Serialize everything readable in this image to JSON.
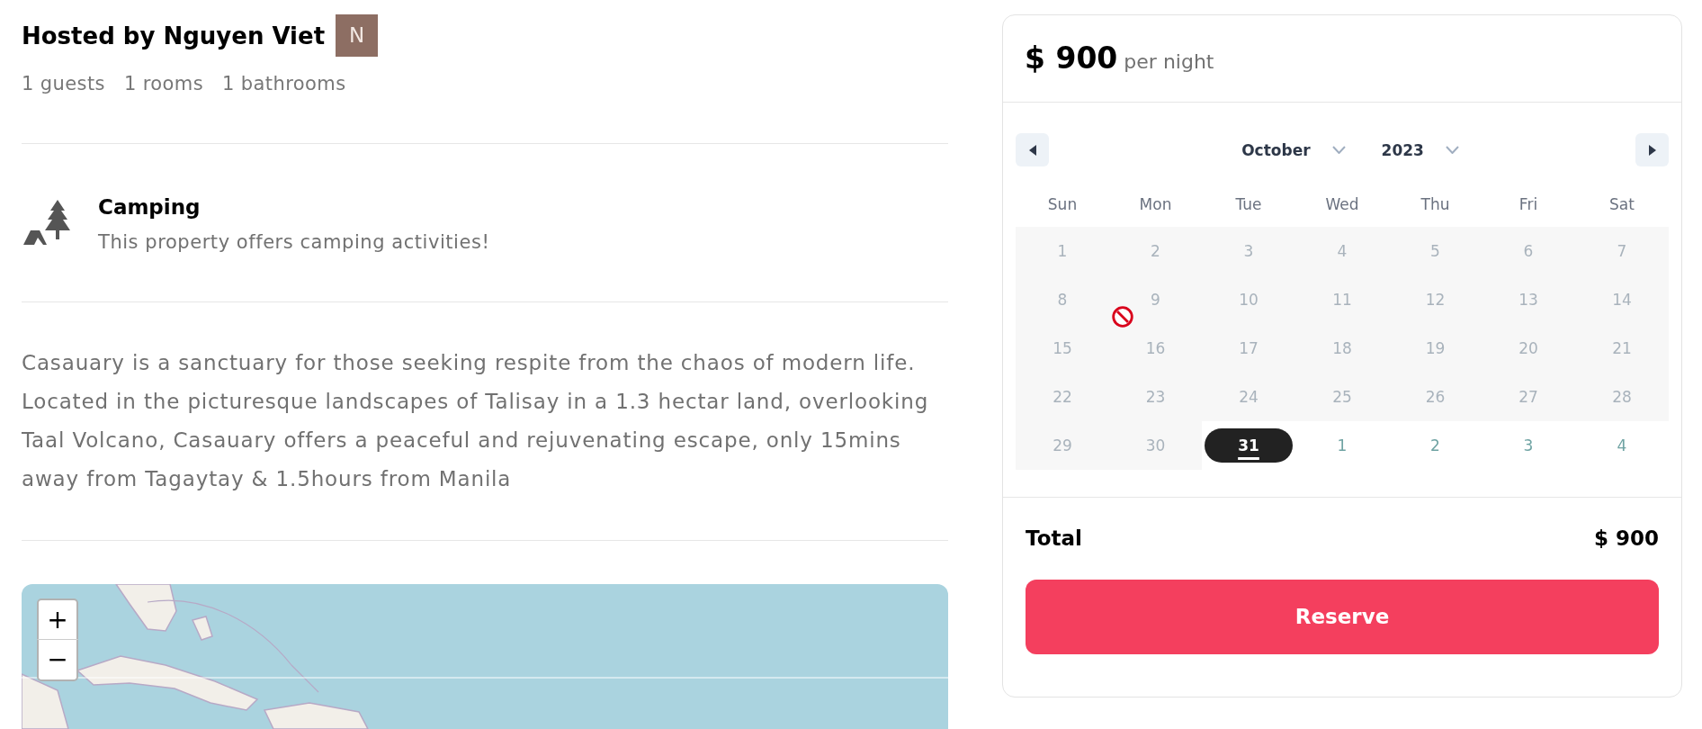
{
  "host": {
    "title": "Hosted by Nguyen Viet",
    "avatar_initial": "N"
  },
  "stats": [
    "1 guests",
    "1 rooms",
    "1 bathrooms"
  ],
  "amenity": {
    "title": "Camping",
    "description": "This property offers camping activities!"
  },
  "description": "Casauary is a sanctuary for those seeking respite from the chaos of modern life. Located in the picturesque landscapes of Talisay in a 1.3 hectar land, overlooking Taal Volcano, Casauary offers a peaceful and rejuvenating escape, only 15mins away from Tagaytay & 1.5hours from Manila",
  "map": {
    "zoom_in": "+",
    "zoom_out": "−"
  },
  "booking": {
    "price": "$ 900",
    "price_unit": "per night",
    "calendar": {
      "month": "October",
      "year": "2023",
      "weekdays": [
        "Sun",
        "Mon",
        "Tue",
        "Wed",
        "Thu",
        "Fri",
        "Sat"
      ],
      "weeks": [
        [
          {
            "label": "1",
            "disabled": true,
            "outside": false,
            "selected": false,
            "today": false
          },
          {
            "label": "2",
            "disabled": true,
            "outside": false,
            "selected": false,
            "today": false
          },
          {
            "label": "3",
            "disabled": true,
            "outside": false,
            "selected": false,
            "today": false
          },
          {
            "label": "4",
            "disabled": true,
            "outside": false,
            "selected": false,
            "today": false
          },
          {
            "label": "5",
            "disabled": true,
            "outside": false,
            "selected": false,
            "today": false
          },
          {
            "label": "6",
            "disabled": true,
            "outside": false,
            "selected": false,
            "today": false
          },
          {
            "label": "7",
            "disabled": true,
            "outside": false,
            "selected": false,
            "today": false
          }
        ],
        [
          {
            "label": "8",
            "disabled": true,
            "outside": false,
            "selected": false,
            "today": false
          },
          {
            "label": "9",
            "disabled": true,
            "outside": false,
            "selected": false,
            "today": false
          },
          {
            "label": "10",
            "disabled": true,
            "outside": false,
            "selected": false,
            "today": false
          },
          {
            "label": "11",
            "disabled": true,
            "outside": false,
            "selected": false,
            "today": false
          },
          {
            "label": "12",
            "disabled": true,
            "outside": false,
            "selected": false,
            "today": false
          },
          {
            "label": "13",
            "disabled": true,
            "outside": false,
            "selected": false,
            "today": false
          },
          {
            "label": "14",
            "disabled": true,
            "outside": false,
            "selected": false,
            "today": false
          }
        ],
        [
          {
            "label": "15",
            "disabled": true,
            "outside": false,
            "selected": false,
            "today": false
          },
          {
            "label": "16",
            "disabled": true,
            "outside": false,
            "selected": false,
            "today": false
          },
          {
            "label": "17",
            "disabled": true,
            "outside": false,
            "selected": false,
            "today": false
          },
          {
            "label": "18",
            "disabled": true,
            "outside": false,
            "selected": false,
            "today": false
          },
          {
            "label": "19",
            "disabled": true,
            "outside": false,
            "selected": false,
            "today": false
          },
          {
            "label": "20",
            "disabled": true,
            "outside": false,
            "selected": false,
            "today": false
          },
          {
            "label": "21",
            "disabled": true,
            "outside": false,
            "selected": false,
            "today": false
          }
        ],
        [
          {
            "label": "22",
            "disabled": true,
            "outside": false,
            "selected": false,
            "today": false
          },
          {
            "label": "23",
            "disabled": true,
            "outside": false,
            "selected": false,
            "today": false
          },
          {
            "label": "24",
            "disabled": true,
            "outside": false,
            "selected": false,
            "today": false
          },
          {
            "label": "25",
            "disabled": true,
            "outside": false,
            "selected": false,
            "today": false
          },
          {
            "label": "26",
            "disabled": true,
            "outside": false,
            "selected": false,
            "today": false
          },
          {
            "label": "27",
            "disabled": true,
            "outside": false,
            "selected": false,
            "today": false
          },
          {
            "label": "28",
            "disabled": true,
            "outside": false,
            "selected": false,
            "today": false
          }
        ],
        [
          {
            "label": "29",
            "disabled": true,
            "outside": false,
            "selected": false,
            "today": false
          },
          {
            "label": "30",
            "disabled": true,
            "outside": false,
            "selected": false,
            "today": false
          },
          {
            "label": "31",
            "disabled": false,
            "outside": false,
            "selected": true,
            "today": true
          },
          {
            "label": "1",
            "disabled": false,
            "outside": true,
            "selected": false,
            "today": false
          },
          {
            "label": "2",
            "disabled": false,
            "outside": true,
            "selected": false,
            "today": false
          },
          {
            "label": "3",
            "disabled": false,
            "outside": true,
            "selected": false,
            "today": false
          },
          {
            "label": "4",
            "disabled": false,
            "outside": true,
            "selected": false,
            "today": false
          }
        ]
      ]
    },
    "total_label": "Total",
    "total_value": "$ 900",
    "reserve_button": "Reserve"
  }
}
